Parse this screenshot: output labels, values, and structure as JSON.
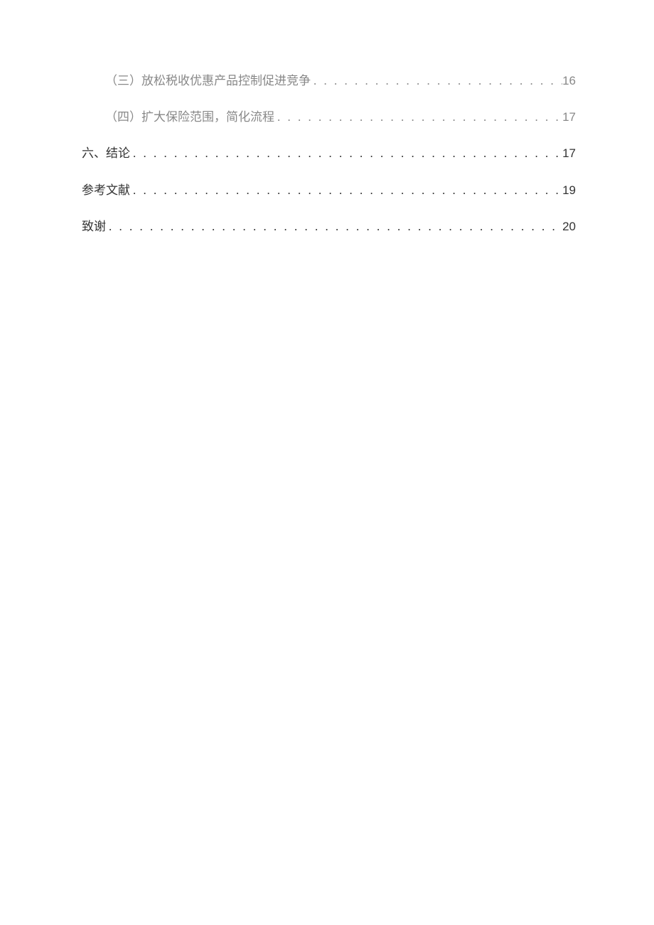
{
  "toc": [
    {
      "level": 2,
      "title": "（三）放松税收优惠产品控制促进竞争",
      "page": "16"
    },
    {
      "level": 2,
      "title": "（四）扩大保险范围，简化流程",
      "page": "17"
    },
    {
      "level": 1,
      "title": "六、结论",
      "page": "17"
    },
    {
      "level": 1,
      "title": "参考文献",
      "page": "19"
    },
    {
      "level": 1,
      "title": "致谢",
      "page": "20"
    }
  ]
}
